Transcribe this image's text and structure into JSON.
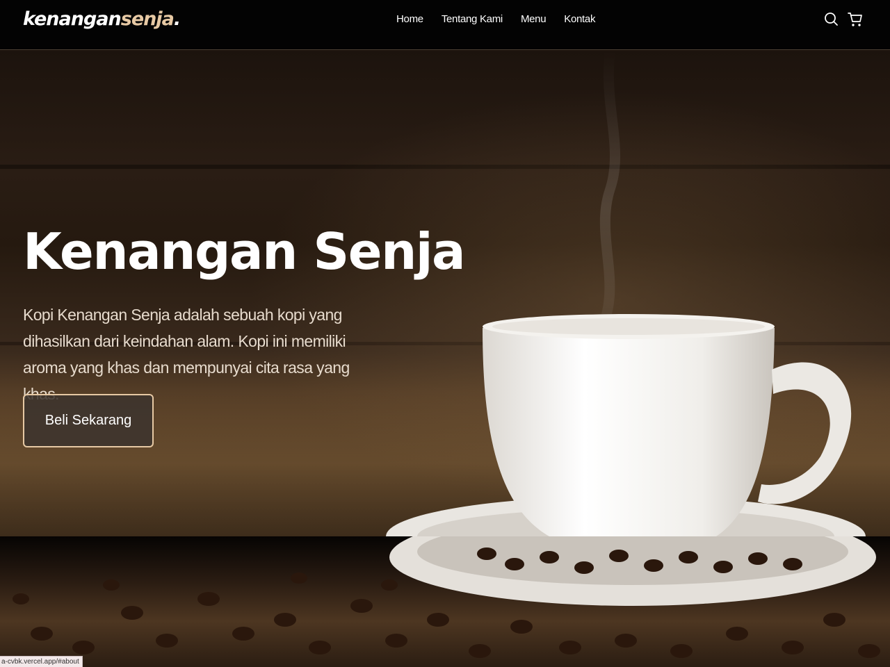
{
  "brand": {
    "logo_main": "kenangan",
    "logo_accent": "senja",
    "logo_dot": "."
  },
  "nav": {
    "links": [
      "Home",
      "Tentang Kami",
      "Menu",
      "Kontak"
    ],
    "icons": [
      "search-icon",
      "cart-icon"
    ]
  },
  "hero": {
    "title": "Kenangan Senja",
    "description": "Kopi Kenangan Senja adalah sebuah kopi yang dihasilkan dari keindahan alam. Kopi ini memiliki aroma yang khas dan mempunyai cita rasa yang khas.",
    "cta_label": "Beli Sekarang"
  },
  "status_bar": {
    "url": "a-cvbk.vercel.app/#about"
  },
  "colors": {
    "accent": "#e7c9a4",
    "navbar_bg": "#030303",
    "text": "#ffffff"
  }
}
